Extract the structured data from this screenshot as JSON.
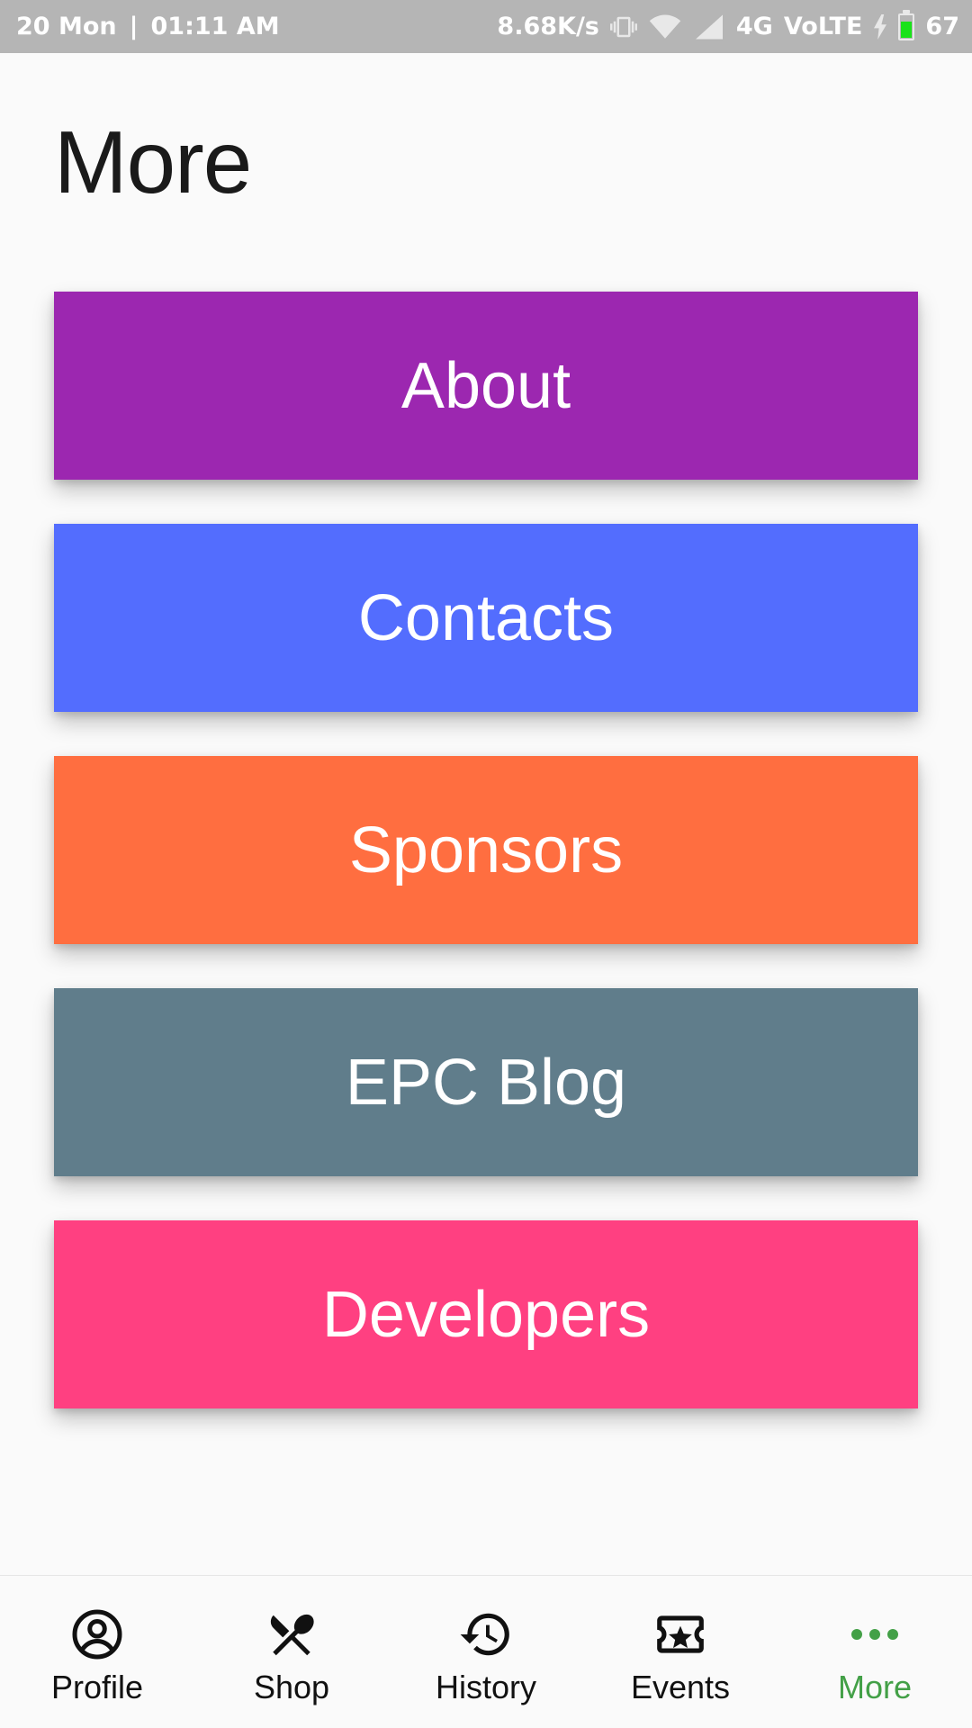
{
  "status_bar": {
    "date": "20 Mon",
    "separator": "|",
    "time": "01:11 AM",
    "speed": "8.68K/s",
    "network": "4G",
    "volte": "VoLTE",
    "battery": "67",
    "battery_color": "#19e219",
    "battery_level": 0.67
  },
  "page": {
    "title": "More"
  },
  "menu": [
    {
      "label": "About",
      "color": "#9c27b0"
    },
    {
      "label": "Contacts",
      "color": "#536dfe"
    },
    {
      "label": "Sponsors",
      "color": "#ff6e40"
    },
    {
      "label": "EPC Blog",
      "color": "#607d8b"
    },
    {
      "label": "Developers",
      "color": "#ff4081"
    }
  ],
  "bottom_nav": {
    "active_color": "#43a047",
    "items": [
      {
        "label": "Profile",
        "icon": "account-circle-icon",
        "active": false
      },
      {
        "label": "Shop",
        "icon": "fork-spoon-icon",
        "active": false
      },
      {
        "label": "History",
        "icon": "history-icon",
        "active": false
      },
      {
        "label": "Events",
        "icon": "ticket-star-icon",
        "active": false
      },
      {
        "label": "More",
        "icon": "more-horiz-icon",
        "active": true
      }
    ]
  }
}
